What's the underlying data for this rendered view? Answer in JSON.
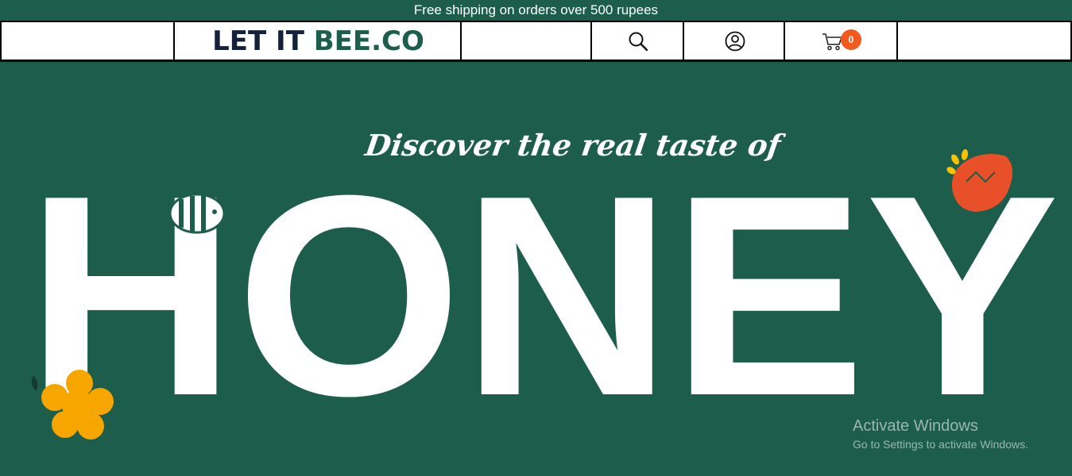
{
  "announcement": "Free shipping on orders over 500 rupees",
  "brand": {
    "part1": "LET IT ",
    "part2": "BEE.CO"
  },
  "header": {
    "cart_count": "0"
  },
  "hero": {
    "tagline": "Discover the real taste of",
    "headline": "HONEY"
  },
  "system_watermark": {
    "title": "Activate Windows",
    "subtitle": "Go to Settings to activate Windows."
  },
  "icons": [
    "search-icon",
    "user-icon",
    "cart-icon",
    "bee-icon",
    "flower-icon"
  ],
  "colors": {
    "brand_green": "#1c5e4b",
    "logo_dark": "#15213a",
    "badge_orange": "#f05a1e",
    "flower_yellow": "#f7a600",
    "flower_red": "#e8502a"
  }
}
